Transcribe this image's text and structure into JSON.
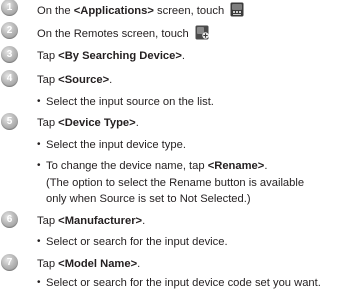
{
  "steps": [
    {
      "number": "1",
      "pre": "On the ",
      "bold": "<Applications>",
      "post": " screen, touch"
    },
    {
      "number": "2",
      "pre": "On the Remotes screen, touch",
      "bold": "",
      "post": ""
    },
    {
      "number": "3",
      "pre": "Tap ",
      "bold": "<By Searching Device>",
      "post": "."
    },
    {
      "number": "4",
      "pre": "Tap ",
      "bold": "<Source>",
      "post": ".",
      "bullet": "Select the input source on the list."
    },
    {
      "number": "5",
      "pre": "Tap ",
      "bold": "<Device Type>",
      "post": ".",
      "bullet": "Select the input device type.",
      "bullet2_pre": "To change the device name, tap ",
      "bullet2_bold": "<Rename>",
      "bullet2_post": ".",
      "note_line1": "(The option to select the Rename button is available",
      "note_line2": "only when Source is set to Not Selected.)"
    },
    {
      "number": "6",
      "pre": "Tap ",
      "bold": "<Manufacturer>",
      "post": ".",
      "bullet": "Select or search for the input device."
    },
    {
      "number": "7",
      "pre": "Tap ",
      "bold": "<Model Name>",
      "post": ".",
      "bullet": "Select or search for the input device code set you want."
    }
  ],
  "icons": {
    "step1": "remote-app-icon",
    "step2": "add-remote-icon"
  }
}
